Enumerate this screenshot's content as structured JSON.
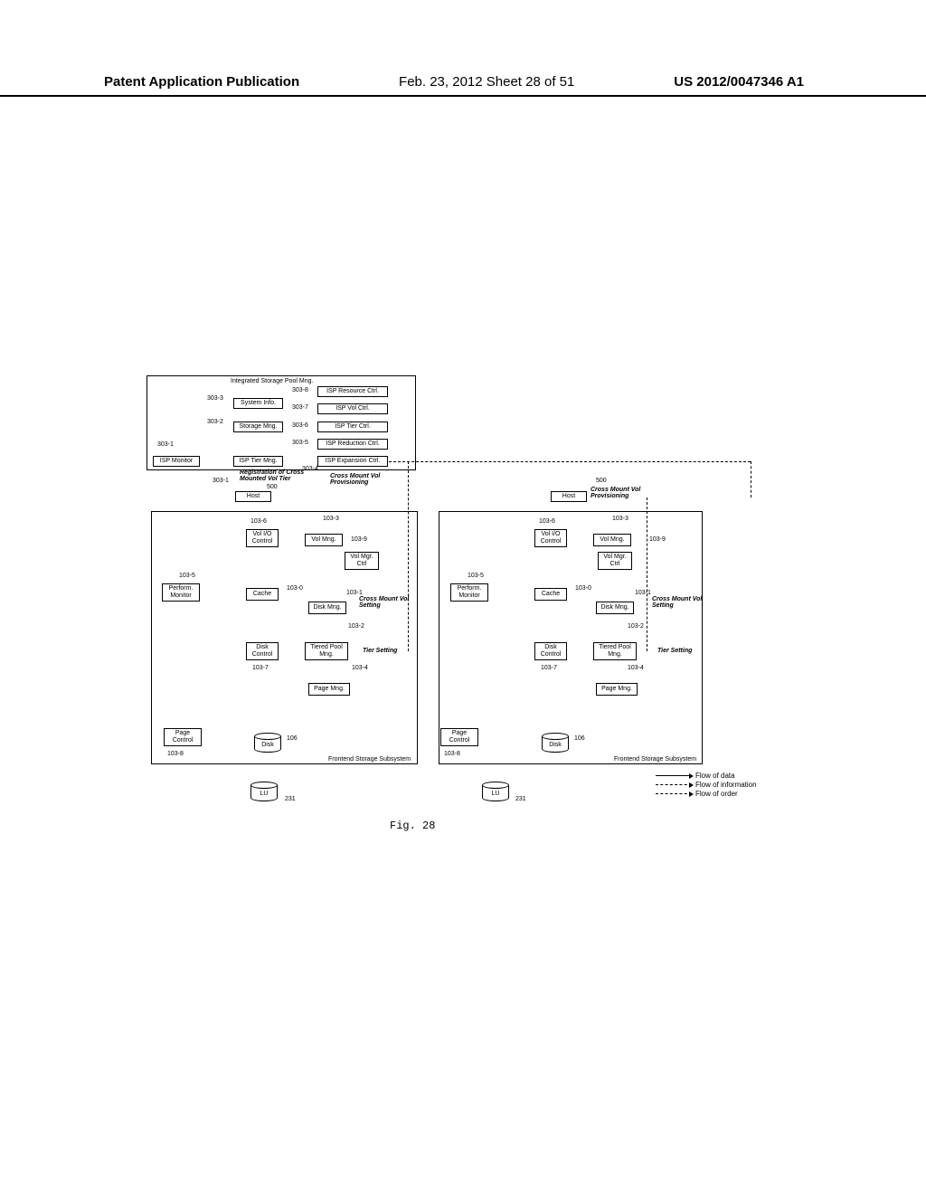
{
  "header": {
    "left": "Patent Application Publication",
    "center": "Feb. 23, 2012  Sheet 28 of 51",
    "right": "US 2012/0047346 A1"
  },
  "isp_mng_title": "Integrated Storage Pool Mng.",
  "isp": {
    "monitor": "ISP Monitor",
    "system_info": "System Info.",
    "storage_mng": "Storage Mng.",
    "tier_mng": "ISP Tier Mng.",
    "resource_ctrl": "ISP Resource Ctrl.",
    "vol_ctrl": "ISP Vol Ctrl.",
    "tier_ctrl": "ISP Tier Ctrl.",
    "reduction_ctrl": "ISP Reduction Ctrl.",
    "expansion_ctrl": "ISP Expansion Ctrl."
  },
  "refs": {
    "r303_1": "303-1",
    "r303_2": "303-2",
    "r303_3": "303-3",
    "r303_4": "303-4",
    "r303_5": "303-5",
    "r303_6": "303-6",
    "r303_7": "303-7",
    "r303_8": "303-8",
    "r103_0": "103-0",
    "r103_1": "103-1",
    "r103_2": "103-2",
    "r103_3": "103-3",
    "r103_4": "103-4",
    "r103_5": "103-5",
    "r103_6": "103-6",
    "r103_7": "103-7",
    "r103_8": "103-8",
    "r103_9": "103-9",
    "r500": "500",
    "r106": "106",
    "r231": "231"
  },
  "annotations": {
    "registration": "Registration of Cross Mounted Vol Tier",
    "provisioning": "Cross Mount Vol Provisioning",
    "cross_mount_setting": "Cross Mount Vol Setting",
    "tier_setting": "Tier Setting"
  },
  "host": "Host",
  "subsystem": {
    "vol_io": "Vol I/O Control",
    "vol_mng": "Vol Mng.",
    "vol_mgr_ctrl": "Vol Mgr. Ctrl",
    "perform_monitor": "Perform. Monitor",
    "cache": "Cache",
    "disk_mng": "Disk Mng.",
    "disk_control": "Disk Control",
    "tiered_pool_mng": "Tiered Pool Mng.",
    "page_mng": "Page Mng.",
    "page_control": "Page Control",
    "disk": "Disk",
    "lu": "LU",
    "title": "Frontend Storage Subsystem"
  },
  "legend": {
    "data": "Flow of data",
    "info": "Flow of information",
    "order": "Flow of order"
  },
  "figure_label": "Fig. 28"
}
